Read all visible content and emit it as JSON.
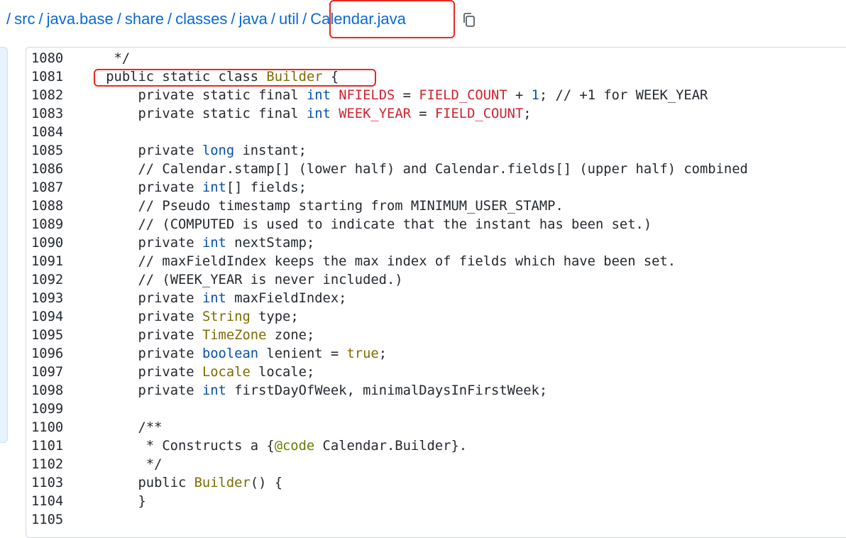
{
  "breadcrumb": {
    "segments": [
      "src",
      "java.base",
      "share",
      "classes",
      "java",
      "util"
    ],
    "current": "Calendar.java",
    "leading_sep": "/",
    "copy_icon": "copy-icon"
  },
  "colors": {
    "link": "#0969da",
    "highlight_box": "#e8281e",
    "keyword": "#0550ae",
    "type": "#7d6b00",
    "constant": "#cf222e"
  },
  "code": {
    "lines": [
      {
        "n": "1080",
        "text": "     */"
      },
      {
        "n": "1081",
        "text": "    public static class Builder {"
      },
      {
        "n": "1082",
        "text": "        private static final int NFIELDS = FIELD_COUNT + 1; // +1 for WEEK_YEAR"
      },
      {
        "n": "1083",
        "text": "        private static final int WEEK_YEAR = FIELD_COUNT;"
      },
      {
        "n": "1084",
        "text": ""
      },
      {
        "n": "1085",
        "text": "        private long instant;"
      },
      {
        "n": "1086",
        "text": "        // Calendar.stamp[] (lower half) and Calendar.fields[] (upper half) combined"
      },
      {
        "n": "1087",
        "text": "        private int[] fields;"
      },
      {
        "n": "1088",
        "text": "        // Pseudo timestamp starting from MINIMUM_USER_STAMP."
      },
      {
        "n": "1089",
        "text": "        // (COMPUTED is used to indicate that the instant has been set.)"
      },
      {
        "n": "1090",
        "text": "        private int nextStamp;"
      },
      {
        "n": "1091",
        "text": "        // maxFieldIndex keeps the max index of fields which have been set."
      },
      {
        "n": "1092",
        "text": "        // (WEEK_YEAR is never included.)"
      },
      {
        "n": "1093",
        "text": "        private int maxFieldIndex;"
      },
      {
        "n": "1094",
        "text": "        private String type;"
      },
      {
        "n": "1095",
        "text": "        private TimeZone zone;"
      },
      {
        "n": "1096",
        "text": "        private boolean lenient = true;"
      },
      {
        "n": "1097",
        "text": "        private Locale locale;"
      },
      {
        "n": "1098",
        "text": "        private int firstDayOfWeek, minimalDaysInFirstWeek;"
      },
      {
        "n": "1099",
        "text": ""
      },
      {
        "n": "1100",
        "text": "        /**"
      },
      {
        "n": "1101",
        "text": "         * Constructs a {@code Calendar.Builder}."
      },
      {
        "n": "1102",
        "text": "         */"
      },
      {
        "n": "1103",
        "text": "        public Builder() {"
      },
      {
        "n": "1104",
        "text": "        }"
      },
      {
        "n": "1105",
        "text": ""
      }
    ]
  }
}
